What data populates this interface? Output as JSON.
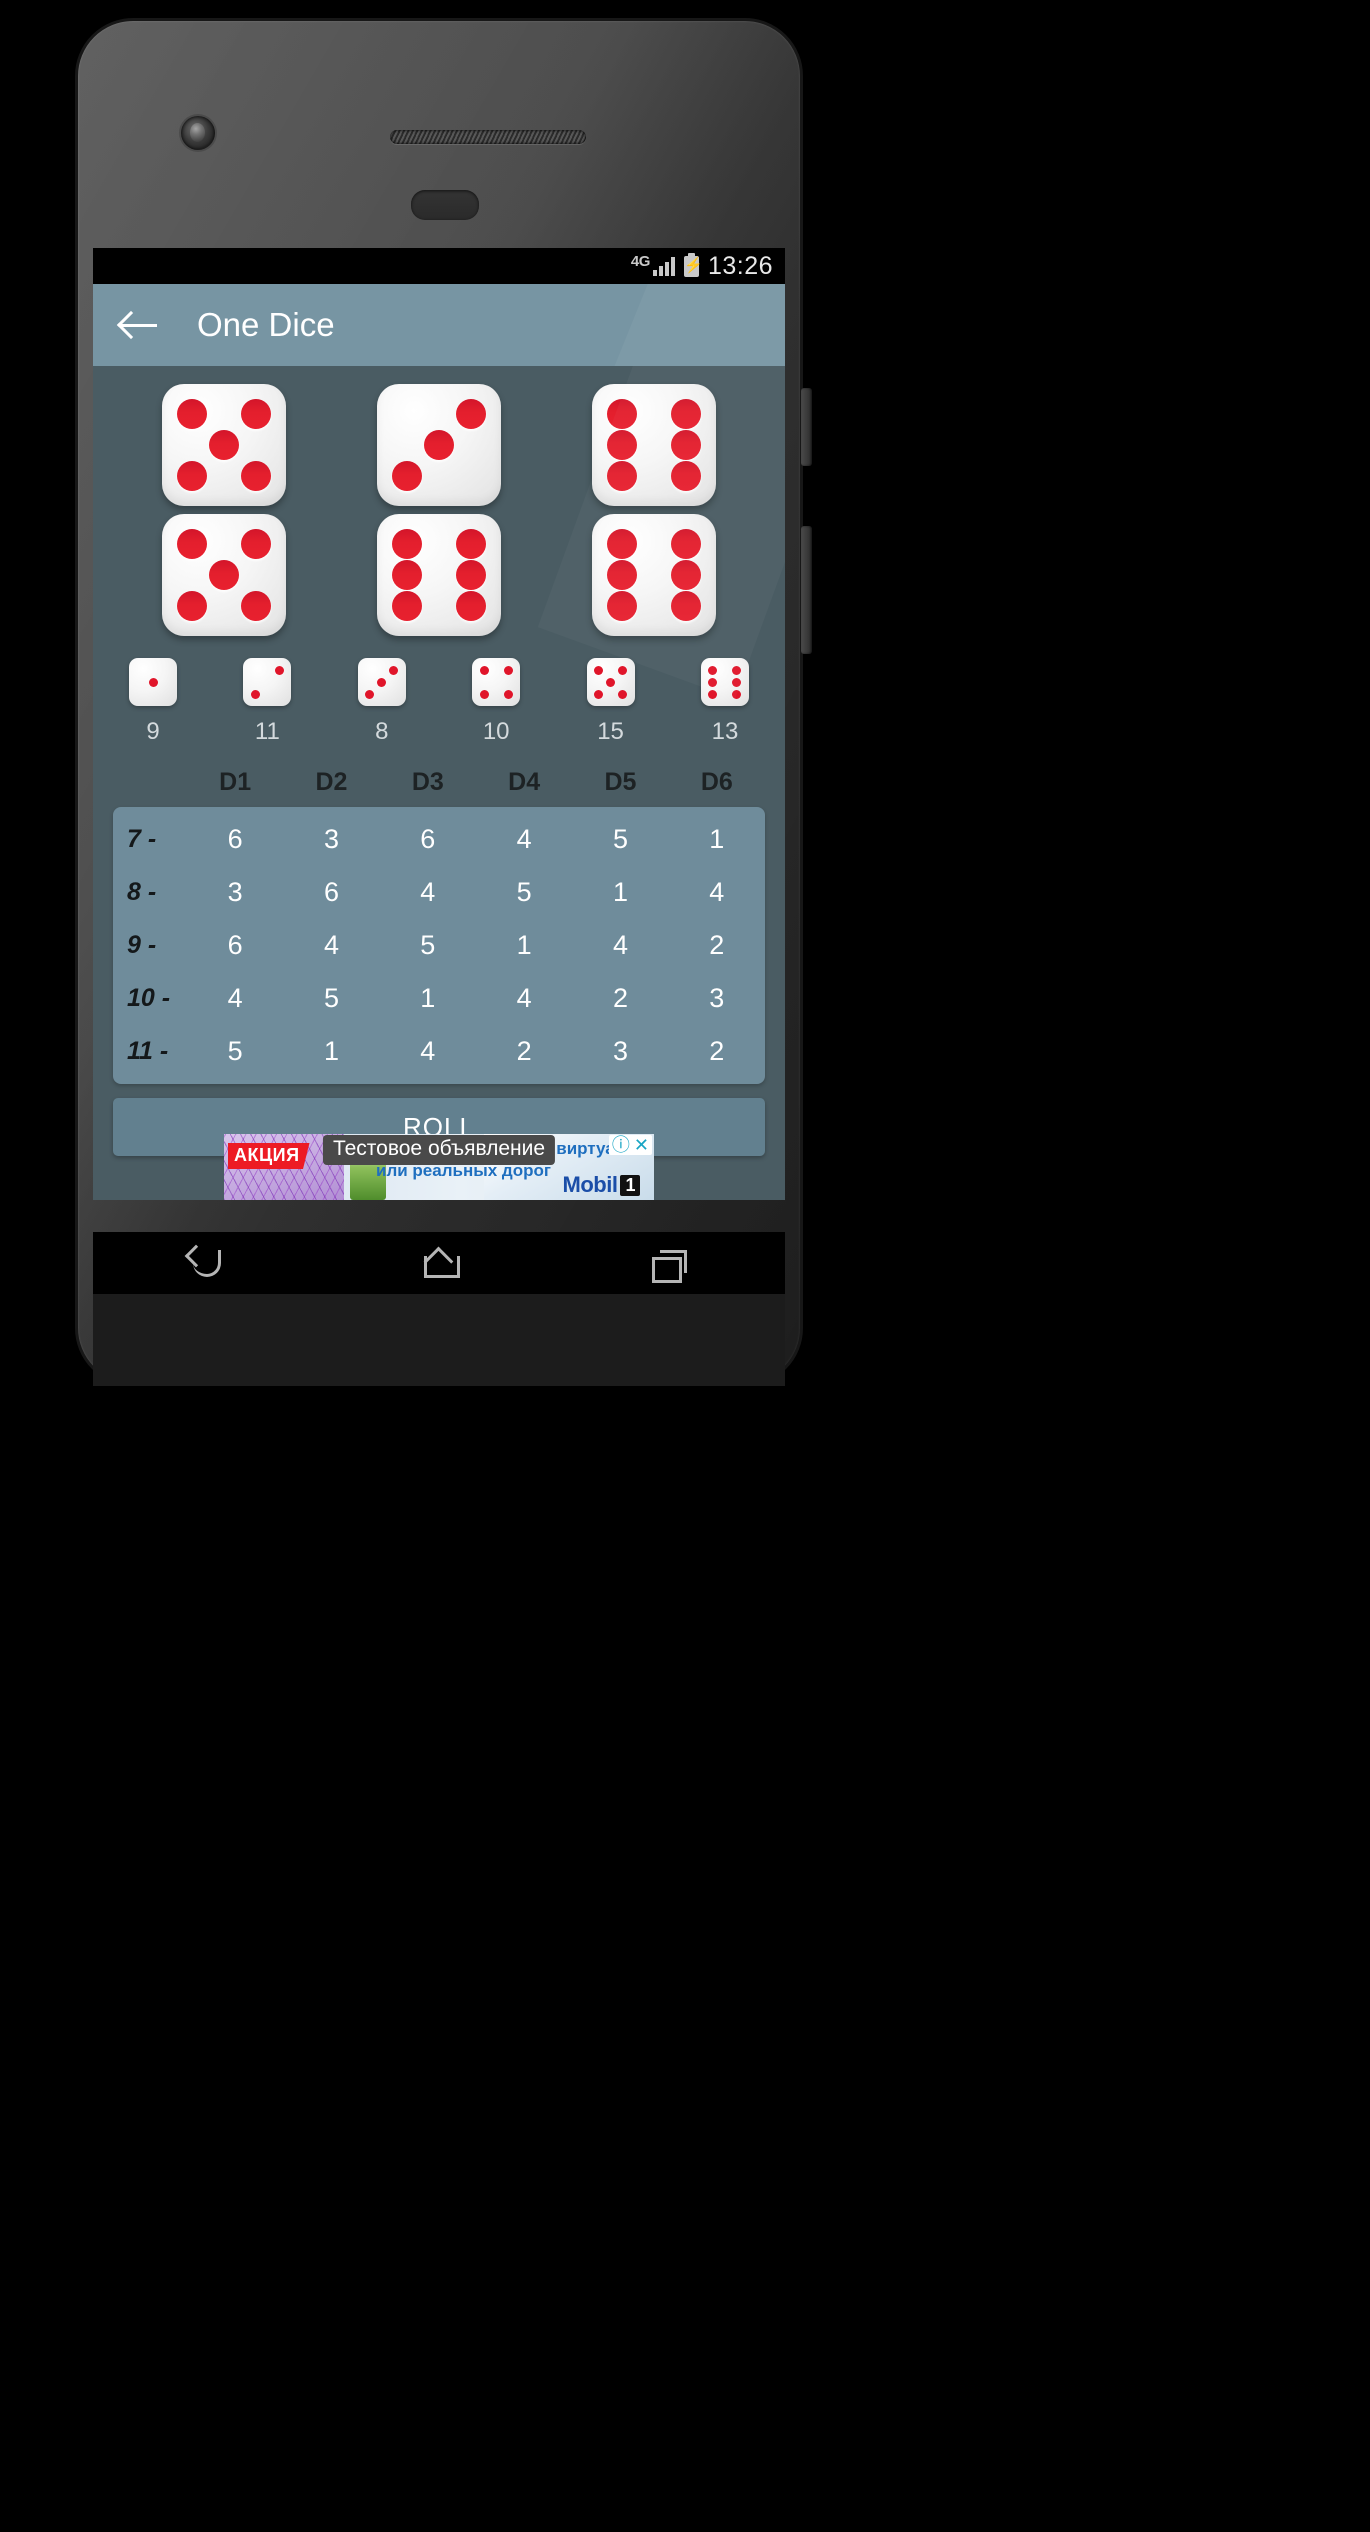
{
  "status_bar": {
    "network": "4G",
    "signal_icon": "signal-bars-icon",
    "battery_icon": "battery-charging-icon",
    "time": "13:26"
  },
  "app_bar": {
    "back_icon": "back-arrow-icon",
    "title": "One Dice"
  },
  "big_dice": [
    {
      "id": "die-1",
      "value": 5
    },
    {
      "id": "die-2",
      "value": 3
    },
    {
      "id": "die-3",
      "value": 6
    },
    {
      "id": "die-4",
      "value": 5
    },
    {
      "id": "die-5",
      "value": 6
    },
    {
      "id": "die-6",
      "value": 6
    }
  ],
  "face_counts": [
    {
      "face": 1,
      "count": "9"
    },
    {
      "face": 2,
      "count": "11"
    },
    {
      "face": 3,
      "count": "8"
    },
    {
      "face": 4,
      "count": "10"
    },
    {
      "face": 5,
      "count": "15"
    },
    {
      "face": 6,
      "count": "13"
    }
  ],
  "history_table": {
    "columns": [
      "D1",
      "D2",
      "D3",
      "D4",
      "D5",
      "D6"
    ],
    "rows": [
      {
        "label": "7 -",
        "values": [
          "6",
          "3",
          "6",
          "4",
          "5",
          "1"
        ]
      },
      {
        "label": "8 -",
        "values": [
          "3",
          "6",
          "4",
          "5",
          "1",
          "4"
        ]
      },
      {
        "label": "9 -",
        "values": [
          "6",
          "4",
          "5",
          "1",
          "4",
          "2"
        ]
      },
      {
        "label": "10 -",
        "values": [
          "4",
          "5",
          "1",
          "4",
          "2",
          "3"
        ]
      },
      {
        "label": "11 -",
        "values": [
          "5",
          "1",
          "4",
          "2",
          "3",
          "2"
        ]
      }
    ]
  },
  "roll_button": {
    "label": "ROLL"
  },
  "ad": {
    "badge": "АКЦИЯ",
    "overlay_text": "Тестовое объявление",
    "line_right_top": "виртуаль",
    "line_bottom": "или реальных дорог",
    "brand": "Mobil",
    "brand_mark": "1",
    "info_icon": "info-icon",
    "close_icon": "close-icon"
  },
  "nav_bar": {
    "back_icon": "nav-back-icon",
    "home_icon": "nav-home-icon",
    "recents_icon": "nav-recents-icon"
  },
  "colors": {
    "screen_bg": "#4a5c63",
    "app_bar": "#7795a3",
    "table_bg": "#6f8c9b",
    "roll_button": "#62808f",
    "pip_red": "#e0152a"
  }
}
